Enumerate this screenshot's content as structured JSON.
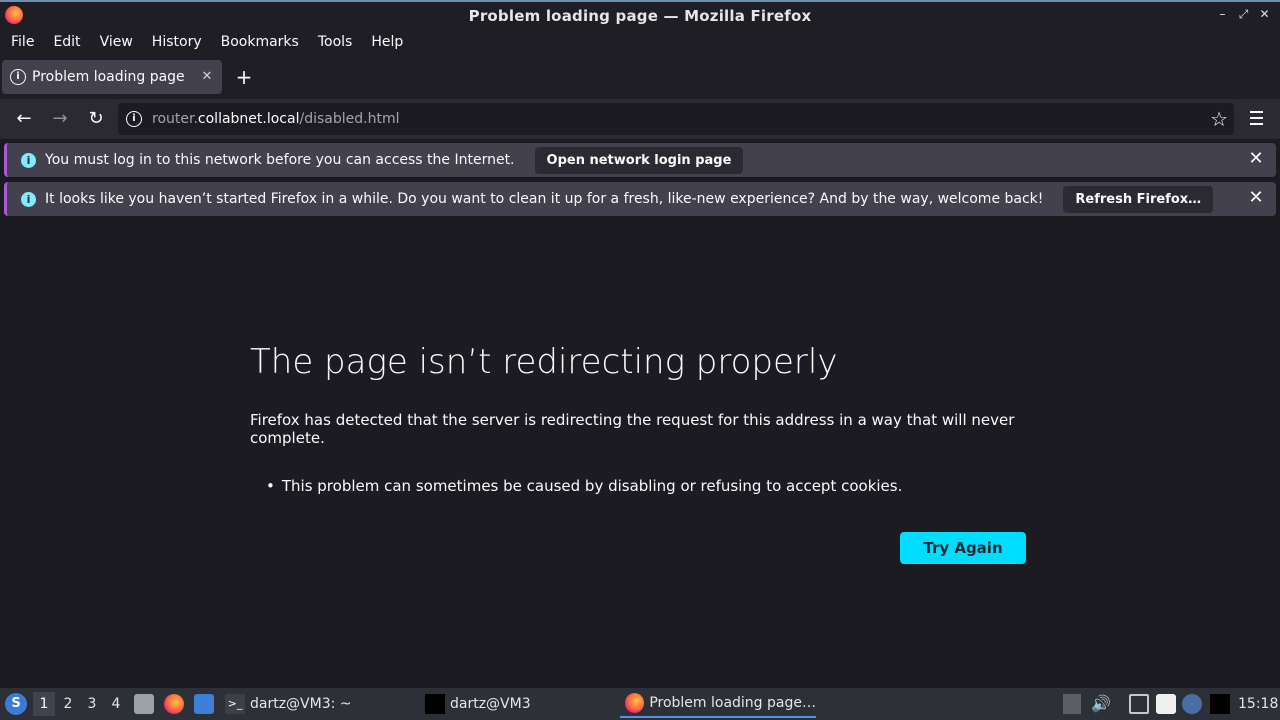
{
  "window": {
    "title": "Problem loading page — Mozilla Firefox",
    "controls": [
      "minimize-icon",
      "maximize-icon",
      "close-icon"
    ]
  },
  "menubar": {
    "items": [
      {
        "label": "File",
        "accel": "F"
      },
      {
        "label": "Edit",
        "accel": "E"
      },
      {
        "label": "View",
        "accel": "V"
      },
      {
        "label": "History",
        "accel": "s"
      },
      {
        "label": "Bookmarks",
        "accel": "B"
      },
      {
        "label": "Tools",
        "accel": "T"
      },
      {
        "label": "Help",
        "accel": "H"
      }
    ]
  },
  "tabs": [
    {
      "label": "Problem loading page",
      "icon": "info-icon",
      "active": true
    }
  ],
  "new_tab_symbol": "+",
  "navbar": {
    "url_host_prefix": "router.",
    "url_domain": "collabnet.local",
    "url_path": "/disabled.html"
  },
  "notifications": [
    {
      "text": "You must log in to this network before you can access the Internet.",
      "button": "Open network login page"
    },
    {
      "text": "It looks like you haven’t started Firefox in a while. Do you want to clean it up for a fresh, like-new experience? And by the way, welcome back!",
      "button": "Refresh Firefox…"
    }
  ],
  "error_page": {
    "title": "The page isn’t redirecting properly",
    "description": "Firefox has detected that the server is redirecting the request for this address in a way that will never complete.",
    "bullets": [
      "This problem can sometimes be caused by disabling or refusing to accept cookies."
    ],
    "try_again": "Try Again"
  },
  "taskbar": {
    "workspaces": [
      "1",
      "2",
      "3",
      "4"
    ],
    "active_workspace": "1",
    "tasks": [
      {
        "label": "dartz@VM3: ~",
        "icon": "terminal-icon"
      },
      {
        "label": "dartz@VM3",
        "icon": "window-icon"
      },
      {
        "label": "Problem loading page…",
        "icon": "firefox-icon",
        "active": true
      }
    ],
    "clock": "15:18"
  },
  "colors": {
    "accent": "#00ddff",
    "notification_icon": "#80ebff",
    "chrome_bg": "#1f1e25",
    "page_bg": "#1c1b22"
  }
}
